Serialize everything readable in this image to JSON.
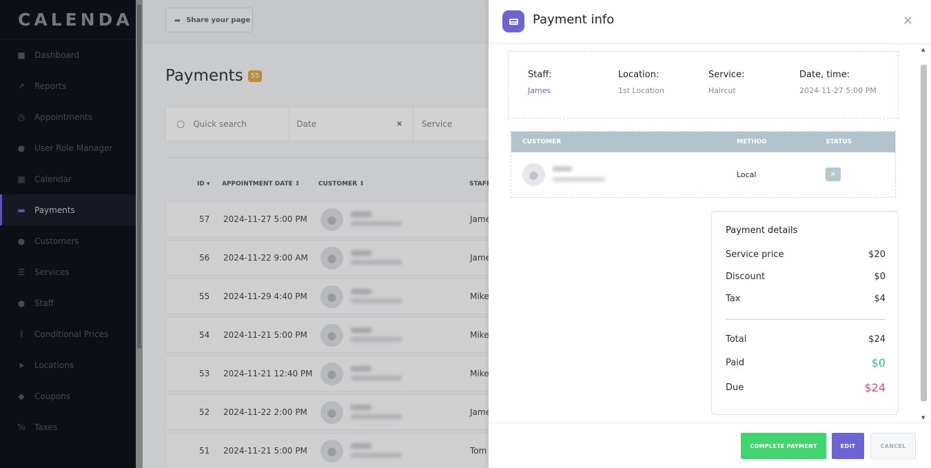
{
  "app": {
    "logo_text": "CALENDA"
  },
  "sidebar": {
    "items": [
      {
        "label": "Dashboard",
        "icon": "cube-icon"
      },
      {
        "label": "Reports",
        "icon": "chart-icon"
      },
      {
        "label": "Appointments",
        "icon": "clock-icon"
      },
      {
        "label": "User Role Manager",
        "icon": "user-plus-icon"
      },
      {
        "label": "Calendar",
        "icon": "calendar-icon"
      },
      {
        "label": "Payments",
        "icon": "card-icon",
        "active": true
      },
      {
        "label": "Customers",
        "icon": "users-icon"
      },
      {
        "label": "Services",
        "icon": "list-icon"
      },
      {
        "label": "Staff",
        "icon": "person-icon"
      },
      {
        "label": "Conditional Prices",
        "icon": "i-cursor-icon"
      },
      {
        "label": "Locations",
        "icon": "location-arrow-icon"
      },
      {
        "label": "Coupons",
        "icon": "tag-icon"
      },
      {
        "label": "Taxes",
        "icon": "percent-icon"
      }
    ]
  },
  "topbar": {
    "share_label": "Share your page"
  },
  "page": {
    "title": "Payments",
    "count": "55"
  },
  "filters": {
    "search_placeholder": "Quick search",
    "date_placeholder": "Date",
    "service_placeholder": "Service"
  },
  "table": {
    "headers": {
      "id": "ID",
      "date": "APPOINTMENT DATE",
      "customer": "CUSTOMER",
      "staff": "STAFF"
    },
    "rows": [
      {
        "id": "57",
        "date": "2024-11-27 5:00 PM",
        "staff": "James"
      },
      {
        "id": "56",
        "date": "2024-11-22 9:00 AM",
        "staff": "James"
      },
      {
        "id": "55",
        "date": "2024-11-29 4:40 PM",
        "staff": "Mike"
      },
      {
        "id": "54",
        "date": "2024-11-21 5:00 PM",
        "staff": "Mike"
      },
      {
        "id": "53",
        "date": "2024-11-21 12:40 PM",
        "staff": "Mike"
      },
      {
        "id": "52",
        "date": "2024-11-22 2:00 PM",
        "staff": "James"
      },
      {
        "id": "51",
        "date": "2024-11-21 5:00 PM",
        "staff": "Tom"
      }
    ]
  },
  "panel": {
    "title": "Payment info",
    "info": {
      "staff_label": "Staff:",
      "staff_value": "James",
      "location_label": "Location:",
      "location_value": "1st Location",
      "service_label": "Service:",
      "service_value": "Haircut",
      "datetime_label": "Date, time:",
      "datetime_value": "2024-11-27 5:00 PM"
    },
    "customer_table": {
      "headers": {
        "customer": "CUSTOMER",
        "method": "METHOD",
        "status": "STATUS"
      },
      "method": "Local"
    },
    "details": {
      "title": "Payment details",
      "service_price_label": "Service price",
      "service_price": "$20",
      "discount_label": "Discount",
      "discount": "$0",
      "tax_label": "Tax",
      "tax": "$4",
      "total_label": "Total",
      "total": "$24",
      "paid_label": "Paid",
      "paid": "$0",
      "due_label": "Due",
      "due": "$24"
    },
    "buttons": {
      "complete": "COMPLETE PAYMENT",
      "edit": "EDIT",
      "cancel": "CANCEL"
    }
  },
  "colors": {
    "accent": "#6c63d6",
    "paid": "#2ecc71",
    "due": "#e5457a",
    "complete": "#41d56f",
    "badge": "#e4a63a"
  }
}
